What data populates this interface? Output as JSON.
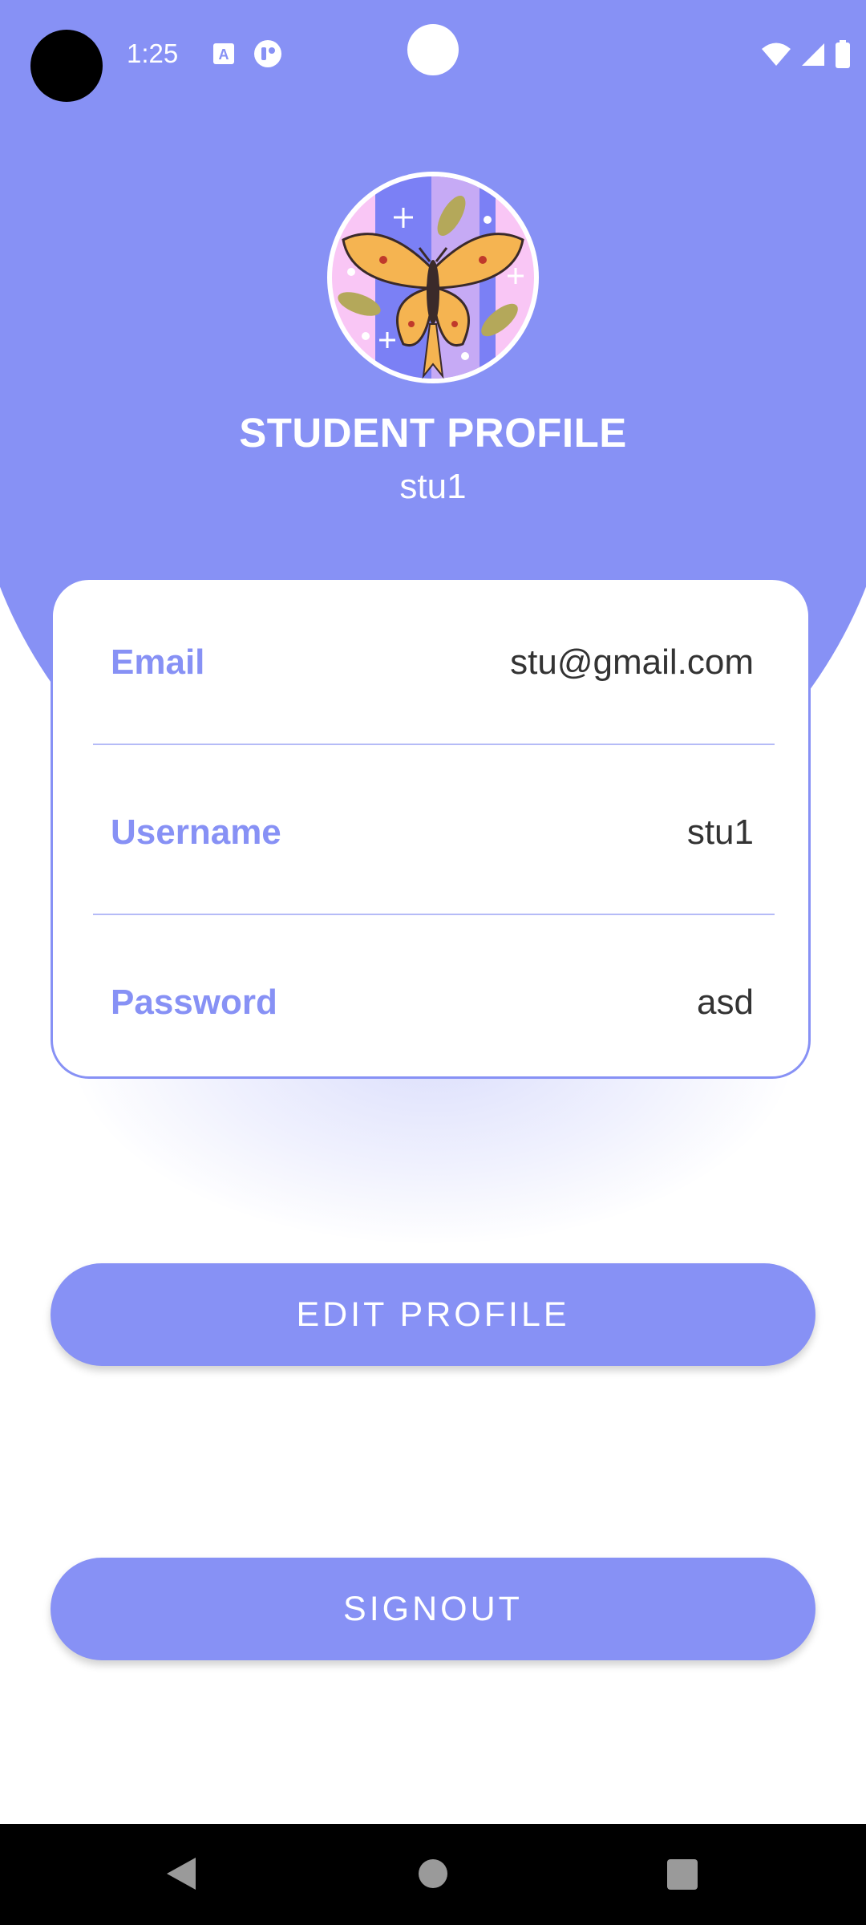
{
  "status_bar": {
    "time": "1:25",
    "icons": [
      "camera-cutout",
      "a-icon",
      "app-icon",
      "wifi-icon",
      "signal-icon",
      "battery-icon"
    ]
  },
  "header": {
    "title": "STUDENT PROFILE",
    "subtitle": "stu1",
    "avatar": "butterfly-avatar"
  },
  "profile": {
    "rows": [
      {
        "label": "Email",
        "value": "stu@gmail.com"
      },
      {
        "label": "Username",
        "value": "stu1"
      },
      {
        "label": "Password",
        "value": "asd"
      }
    ]
  },
  "buttons": {
    "edit_label": "EDIT PROFILE",
    "signout_label": "SIGNOUT"
  },
  "nav": {
    "icons": [
      "back-icon",
      "home-icon",
      "recent-apps-icon"
    ]
  },
  "colors": {
    "accent": "#8791f5",
    "text_dark": "#333333",
    "background": "#ffffff"
  }
}
